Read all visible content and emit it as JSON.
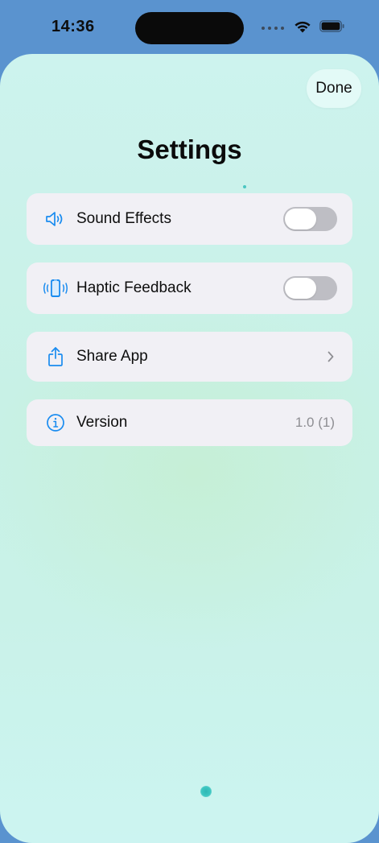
{
  "status_bar": {
    "time": "14:36"
  },
  "sheet": {
    "done_label": "Done",
    "title": "Settings"
  },
  "settings": {
    "items": [
      {
        "label": "Sound Effects",
        "icon": "speaker-icon",
        "control": "toggle",
        "on": false
      },
      {
        "label": "Haptic Feedback",
        "icon": "haptic-phone-icon",
        "control": "toggle",
        "on": false
      },
      {
        "label": "Share App",
        "icon": "share-icon",
        "control": "chevron"
      },
      {
        "label": "Version",
        "icon": "info-icon",
        "control": "value",
        "value": "1.0 (1)"
      }
    ]
  },
  "colors": {
    "accent": "#1a8cf0",
    "status_bar_bg": "#5a93cf",
    "row_bg": "#f1f0f5",
    "toggle_off": "#bebec4",
    "secondary_text": "#8e8e93"
  }
}
